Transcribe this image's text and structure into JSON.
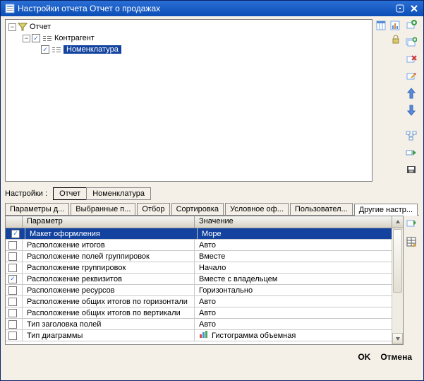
{
  "window": {
    "title": "Настройки отчета  Отчет о продажах"
  },
  "tree": {
    "root": "Отчет",
    "child1": "Контрагент",
    "child2": "Номенклатура"
  },
  "settings_line": {
    "label": "Настройки :",
    "tab1": "Отчет",
    "tab2": "Номенклатура"
  },
  "subtabs": {
    "t1": "Параметры д...",
    "t2": "Выбранные п...",
    "t3": "Отбор",
    "t4": "Сортировка",
    "t5": "Условное оф...",
    "t6": "Пользовател...",
    "t7": "Другие настр..."
  },
  "grid": {
    "header": {
      "c1": "Параметр",
      "c2": "Значение"
    },
    "rows": [
      {
        "checked": true,
        "param": "Макет оформления",
        "value": "Море",
        "selected": true,
        "icon": null
      },
      {
        "checked": false,
        "param": "Расположение итогов",
        "value": "Авто",
        "selected": false,
        "icon": null
      },
      {
        "checked": false,
        "param": "Расположение полей группировок",
        "value": "Вместе",
        "selected": false,
        "icon": null
      },
      {
        "checked": false,
        "param": "Расположение группировок",
        "value": "Начало",
        "selected": false,
        "icon": null
      },
      {
        "checked": true,
        "param": "Расположение реквизитов",
        "value": "Вместе с владельцем",
        "selected": false,
        "icon": null
      },
      {
        "checked": false,
        "param": "Расположение ресурсов",
        "value": "Горизонтально",
        "selected": false,
        "icon": null
      },
      {
        "checked": false,
        "param": "Расположение общих итогов по горизонтали",
        "value": "Авто",
        "selected": false,
        "icon": null
      },
      {
        "checked": false,
        "param": "Расположение общих итогов по вертикали",
        "value": "Авто",
        "selected": false,
        "icon": null
      },
      {
        "checked": false,
        "param": "Тип заголовка полей",
        "value": "Авто",
        "selected": false,
        "icon": null
      },
      {
        "checked": false,
        "param": "Тип диаграммы",
        "value": "Гистограмма объемная",
        "selected": false,
        "icon": "bars"
      }
    ]
  },
  "footer": {
    "ok": "OK",
    "cancel": "Отмена"
  }
}
